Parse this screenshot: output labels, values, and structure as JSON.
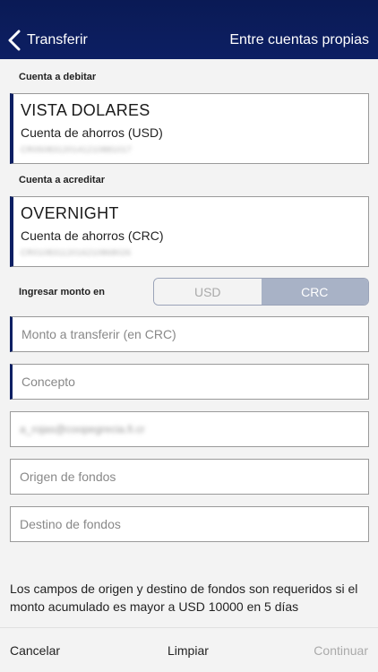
{
  "header": {
    "back_label": "Transferir",
    "right_title": "Entre cuentas propias"
  },
  "debit": {
    "section_label": "Cuenta a debitar",
    "name": "VISTA DOLARES",
    "type": "Cuenta de ahorros (USD)",
    "number": "CR05083120141210881017"
  },
  "credit": {
    "section_label": "Cuenta a acreditar",
    "name": "OVERNIGHT",
    "type": "Cuenta de ahorros (CRC)",
    "number": "CR01083112016210868026"
  },
  "amount": {
    "label": "Ingresar monto en",
    "options": [
      "USD",
      "CRC"
    ],
    "selected": "CRC"
  },
  "fields": {
    "amount_placeholder": "Monto a transferir (en CRC)",
    "concept_placeholder": "Concepto",
    "email_value": "a_rojas@coopegrecia.fi.cr",
    "origin_placeholder": "Origen de fondos",
    "destination_placeholder": "Destino de fondos"
  },
  "note": "Los campos de origen y destino de fondos son requeridos si el monto acumulado es mayor a USD 10000 en 5 días",
  "footer": {
    "cancel": "Cancelar",
    "clear": "Limpiar",
    "continue": "Continuar"
  },
  "colors": {
    "header": "#0d1f63",
    "segment_selected": "#a8b2c6",
    "disabled_text": "#aaaaaa"
  }
}
